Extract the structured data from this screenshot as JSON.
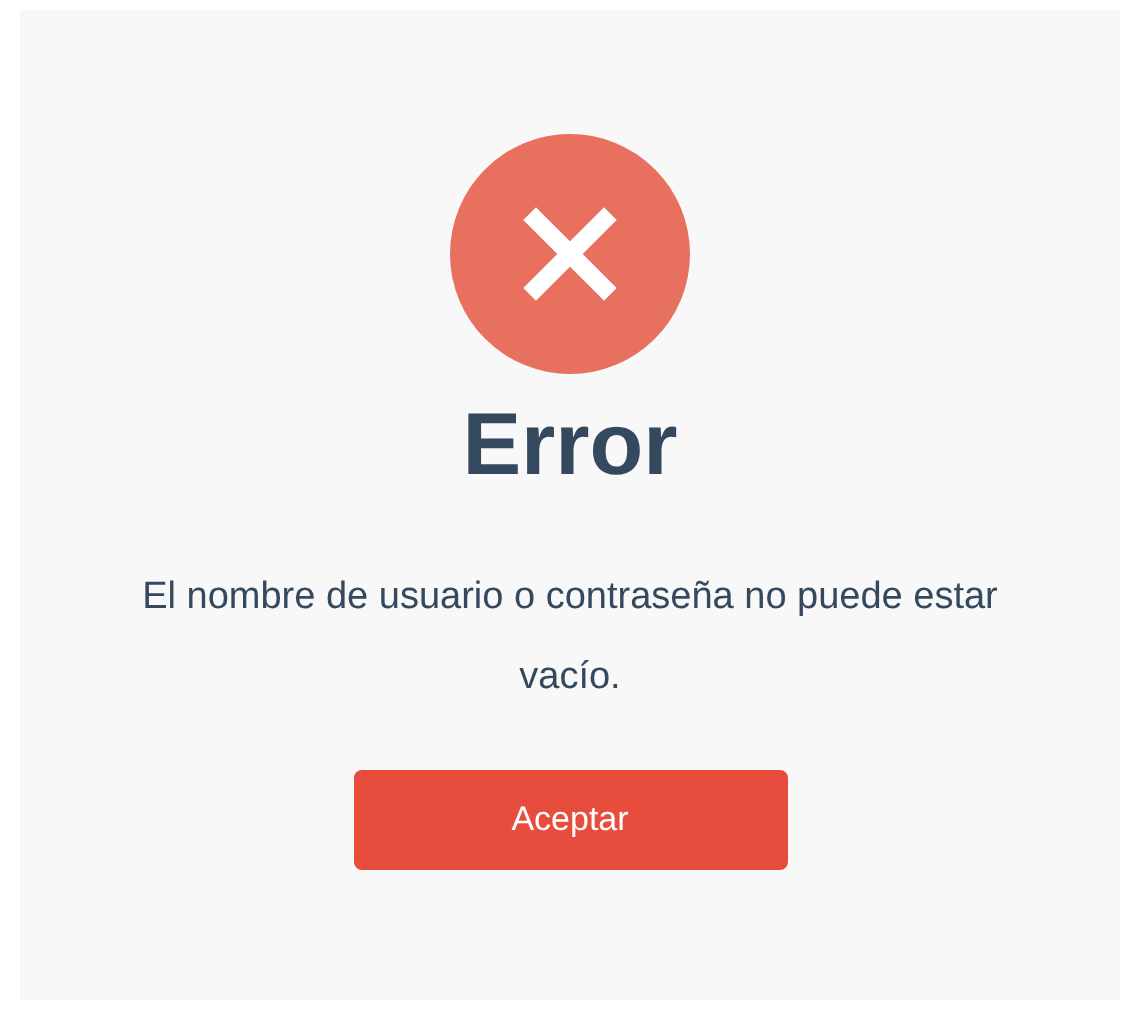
{
  "dialog": {
    "title": "Error",
    "message": "El nombre de usuario o contraseña no puede estar vacío.",
    "buttons": [
      "Aceptar"
    ]
  }
}
